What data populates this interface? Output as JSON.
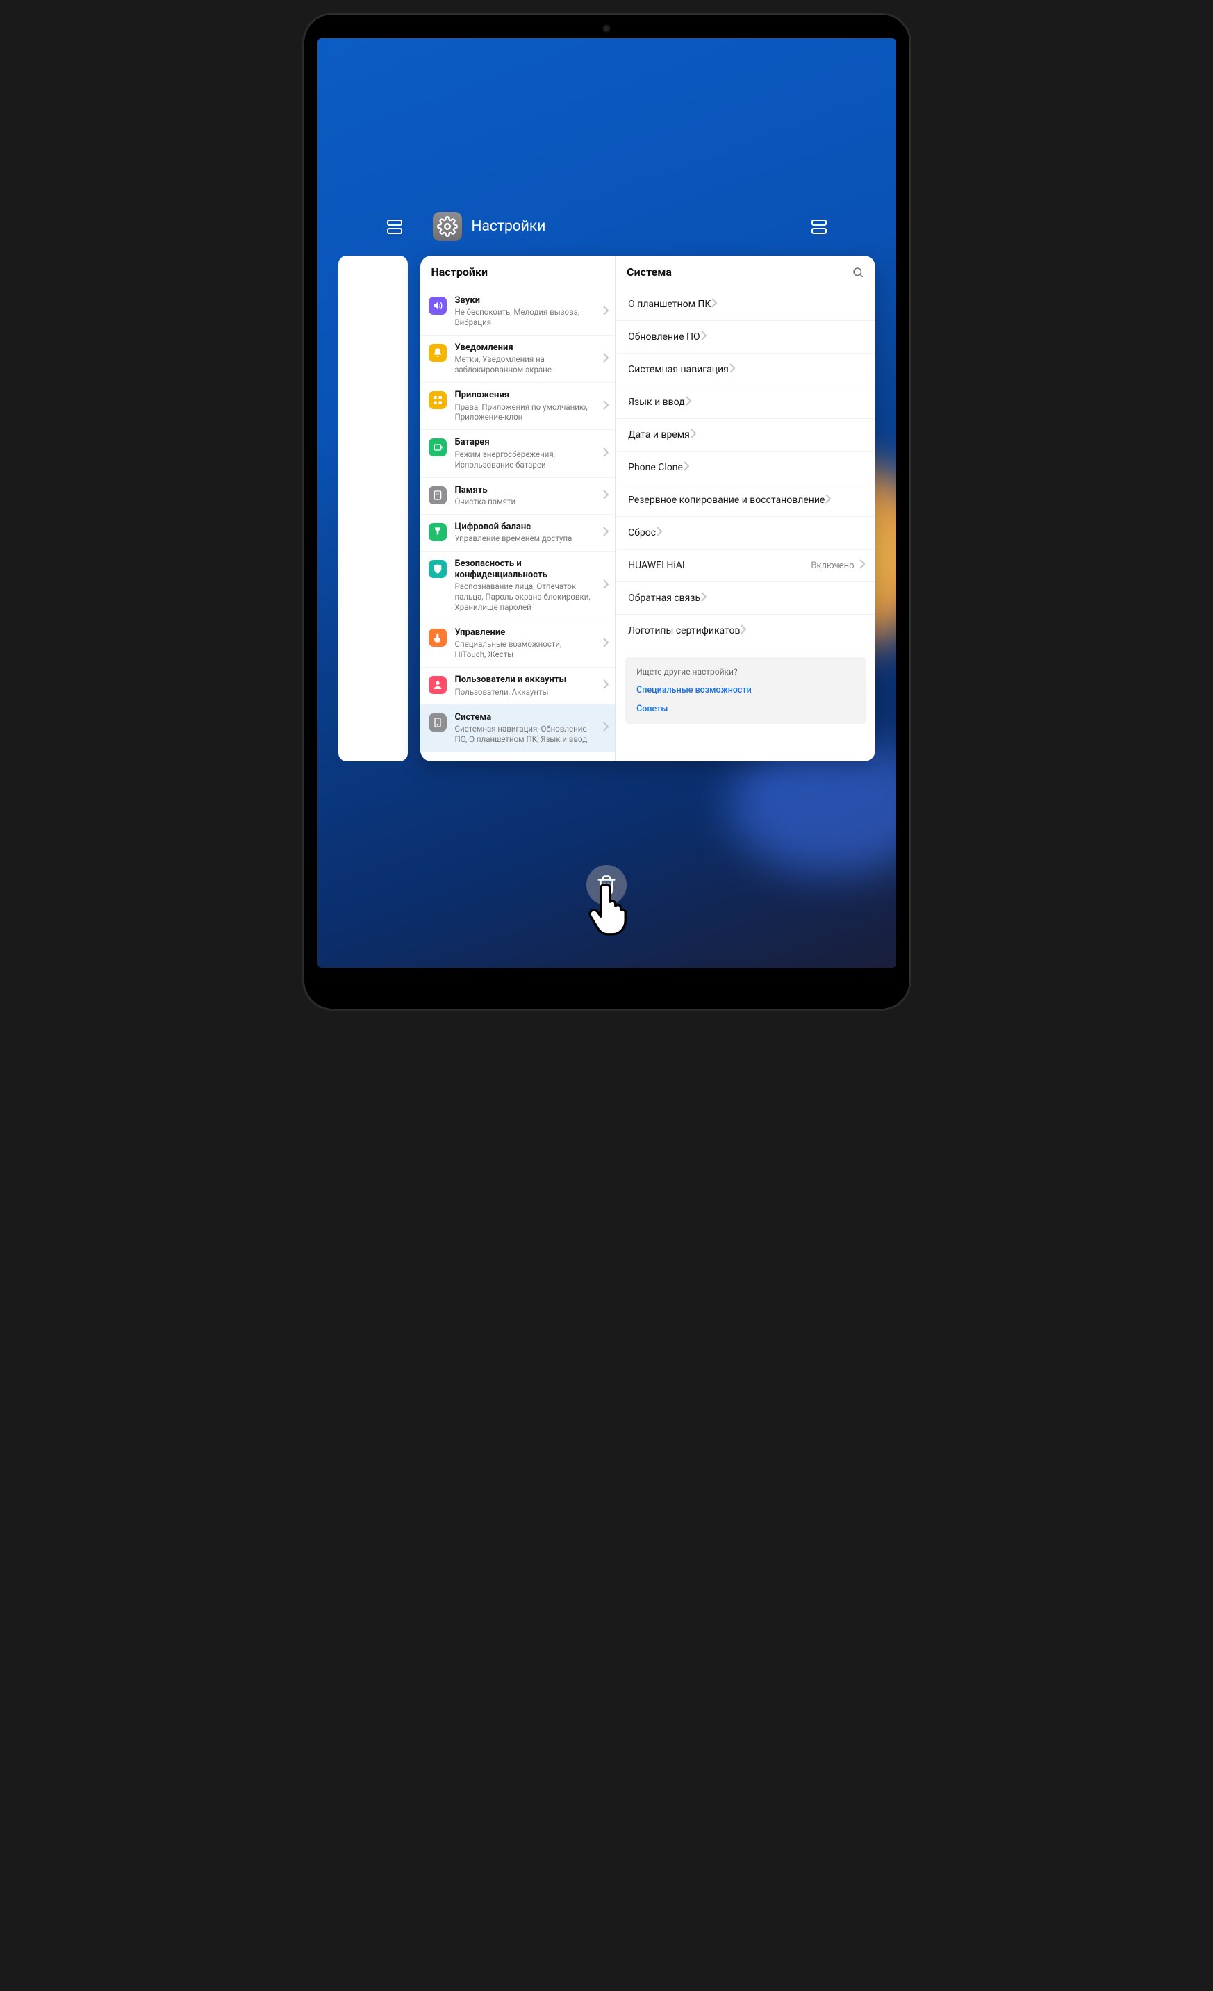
{
  "app": {
    "title": "Настройки"
  },
  "left_header": "Настройки",
  "right_header": "Система",
  "settings": [
    {
      "icon": "sound",
      "title": "Звуки",
      "sub": "Не беспокоить, Мелодия вызова, Вибрация"
    },
    {
      "icon": "notif",
      "title": "Уведомления",
      "sub": "Метки, Уведомления на заблокированном экране"
    },
    {
      "icon": "apps",
      "title": "Приложения",
      "sub": "Права, Приложения по умолчанию, Приложение-клон"
    },
    {
      "icon": "battery",
      "title": "Батарея",
      "sub": "Режим энергосбережения, Использование батареи"
    },
    {
      "icon": "storage",
      "title": "Память",
      "sub": "Очистка памяти"
    },
    {
      "icon": "balance",
      "title": "Цифровой баланс",
      "sub": "Управление временем доступа"
    },
    {
      "icon": "security",
      "title": "Безопасность и конфиденциальность",
      "sub": "Распознавание лица, Отпечаток пальца, Пароль экрана блокировки, Хранилище паролей"
    },
    {
      "icon": "gesture",
      "title": "Управление",
      "sub": "Специальные возможности, HiTouch, Жесты"
    },
    {
      "icon": "users",
      "title": "Пользователи и аккаунты",
      "sub": "Пользователи, Аккаунты"
    },
    {
      "icon": "system",
      "title": "Система",
      "sub": "Системная навигация, Обновление ПО, О планшетном ПК, Язык и ввод"
    }
  ],
  "system": {
    "groups": [
      [
        {
          "label": "О планшетном ПК"
        },
        {
          "label": "Обновление ПО"
        }
      ],
      [
        {
          "label": "Системная навигация"
        }
      ],
      [
        {
          "label": "Язык и ввод"
        },
        {
          "label": "Дата и время"
        }
      ],
      [
        {
          "label": "Phone Clone"
        },
        {
          "label": "Резервное копирование и восстановление"
        },
        {
          "label": "Сброс"
        }
      ],
      [
        {
          "label": "HUAWEI HiAI",
          "value": "Включено"
        },
        {
          "label": "Обратная связь"
        },
        {
          "label": "Логотипы сертификатов"
        }
      ]
    ],
    "more": {
      "prompt": "Ищете другие настройки?",
      "links": [
        "Специальные возможности",
        "Советы"
      ]
    }
  },
  "icon_colors": {
    "sound": "#7a5af8",
    "notif": "#f5b500",
    "apps": "#f5b500",
    "battery": "#1fbf6b",
    "storage": "#8e8e93",
    "balance": "#1fbf6b",
    "security": "#14b8a6",
    "gesture": "#ff7a2f",
    "users": "#ff4d6a",
    "system": "#8e8e93"
  }
}
